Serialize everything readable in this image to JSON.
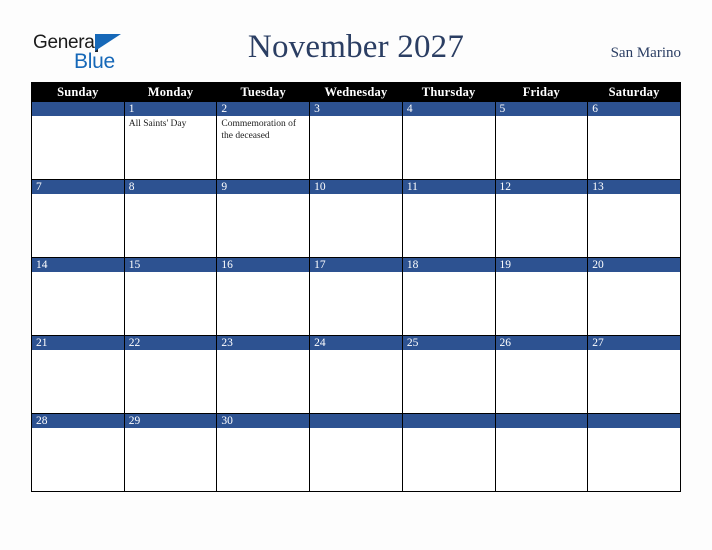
{
  "brand": {
    "line1": "General",
    "line2": "Blue",
    "logo_accent_color": "#1668b8",
    "logo_text_color": "#1b1b1b"
  },
  "header": {
    "title": "November 2027",
    "location": "San Marino",
    "title_color": "#2b3e63"
  },
  "theme": {
    "header_row_bg": "#000000",
    "header_row_text": "#ffffff",
    "daybar_bg": "#2d5291",
    "daybar_text": "#ffffff",
    "cell_bg": "#ffffff",
    "grid_line": "#000000",
    "page_bg": "#fdfdfd"
  },
  "weekdays": [
    "Sunday",
    "Monday",
    "Tuesday",
    "Wednesday",
    "Thursday",
    "Friday",
    "Saturday"
  ],
  "weeks": [
    [
      {
        "day": "",
        "events": []
      },
      {
        "day": "1",
        "events": [
          "All Saints' Day"
        ]
      },
      {
        "day": "2",
        "events": [
          "Commemoration of the deceased"
        ]
      },
      {
        "day": "3",
        "events": []
      },
      {
        "day": "4",
        "events": []
      },
      {
        "day": "5",
        "events": []
      },
      {
        "day": "6",
        "events": []
      }
    ],
    [
      {
        "day": "7",
        "events": []
      },
      {
        "day": "8",
        "events": []
      },
      {
        "day": "9",
        "events": []
      },
      {
        "day": "10",
        "events": []
      },
      {
        "day": "11",
        "events": []
      },
      {
        "day": "12",
        "events": []
      },
      {
        "day": "13",
        "events": []
      }
    ],
    [
      {
        "day": "14",
        "events": []
      },
      {
        "day": "15",
        "events": []
      },
      {
        "day": "16",
        "events": []
      },
      {
        "day": "17",
        "events": []
      },
      {
        "day": "18",
        "events": []
      },
      {
        "day": "19",
        "events": []
      },
      {
        "day": "20",
        "events": []
      }
    ],
    [
      {
        "day": "21",
        "events": []
      },
      {
        "day": "22",
        "events": []
      },
      {
        "day": "23",
        "events": []
      },
      {
        "day": "24",
        "events": []
      },
      {
        "day": "25",
        "events": []
      },
      {
        "day": "26",
        "events": []
      },
      {
        "day": "27",
        "events": []
      }
    ],
    [
      {
        "day": "28",
        "events": []
      },
      {
        "day": "29",
        "events": []
      },
      {
        "day": "30",
        "events": []
      },
      {
        "day": "",
        "events": []
      },
      {
        "day": "",
        "events": []
      },
      {
        "day": "",
        "events": []
      },
      {
        "day": "",
        "events": []
      }
    ]
  ]
}
